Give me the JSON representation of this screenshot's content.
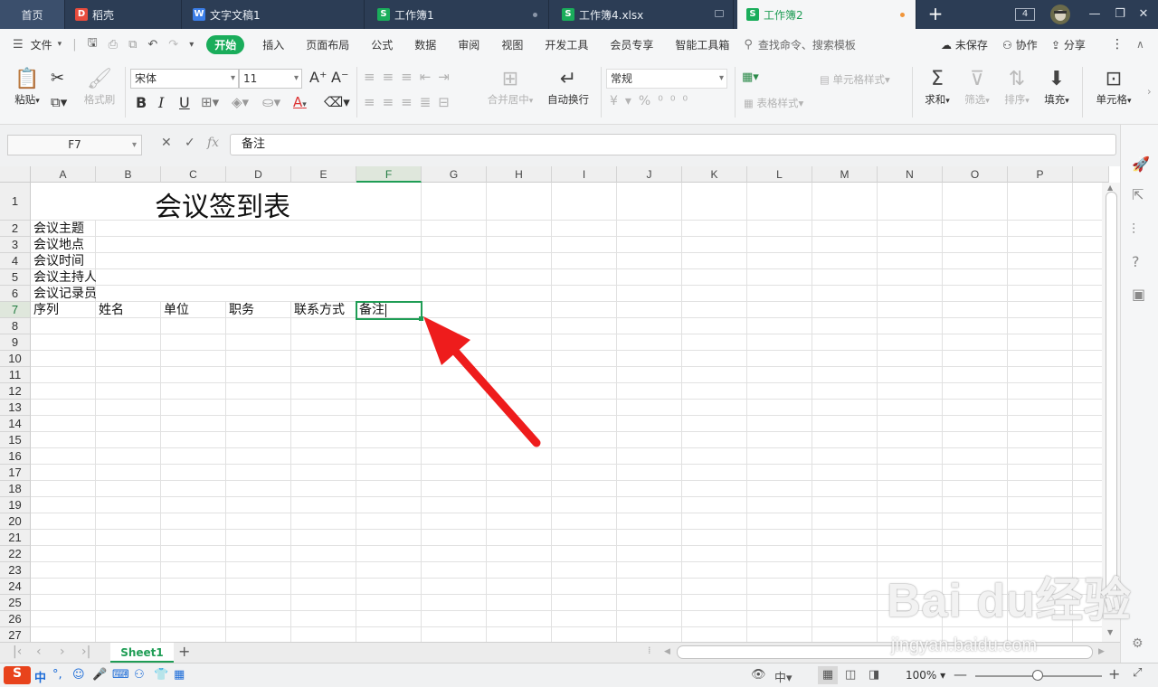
{
  "tabs": {
    "home": "首页",
    "items": [
      {
        "label": "稻壳",
        "icon": "docer-icon",
        "color": "#e84c3d"
      },
      {
        "label": "文字文稿1",
        "icon": "writer-icon",
        "color": "#3b7ee8"
      },
      {
        "label": "工作簿1",
        "icon": "spreadsheet-icon",
        "color": "#1aad5b"
      },
      {
        "label": "工作簿4.xlsx",
        "icon": "spreadsheet-icon",
        "color": "#1aad5b"
      },
      {
        "label": "工作簿2",
        "icon": "spreadsheet-icon",
        "color": "#1aad5b"
      }
    ],
    "window_count": "4"
  },
  "menu": {
    "file": "文件",
    "items": [
      "开始",
      "插入",
      "页面布局",
      "公式",
      "数据",
      "审阅",
      "视图",
      "开发工具",
      "会员专享",
      "智能工具箱"
    ],
    "search": "查找命令、搜索模板",
    "unsaved": "未保存",
    "collab": "协作",
    "share": "分享"
  },
  "ribbon": {
    "paste": "粘贴",
    "format_painter": "格式刷",
    "font_name": "宋体",
    "font_size": "11",
    "merge_center": "合并居中",
    "wrap_text": "自动换行",
    "number_format": "常规",
    "cell_style": "单元格样式",
    "table_style": "表格样式",
    "sum": "求和",
    "filter": "筛选",
    "sort": "排序",
    "fill": "填充",
    "cells": "单元格"
  },
  "formula_bar": {
    "name_box": "F7",
    "content": "备注"
  },
  "grid": {
    "columns": [
      "A",
      "B",
      "C",
      "D",
      "E",
      "F",
      "G",
      "H",
      "I",
      "J",
      "K",
      "L",
      "M",
      "N",
      "O",
      "P"
    ],
    "rows": [
      "1",
      "2",
      "3",
      "4",
      "5",
      "6",
      "7",
      "8",
      "9",
      "10",
      "11",
      "12",
      "13",
      "14",
      "15",
      "16",
      "17",
      "18",
      "19",
      "20",
      "21",
      "22",
      "23",
      "24",
      "25",
      "26",
      "27"
    ],
    "selected_column": "F",
    "selected_row": "7",
    "title": "会议签到表",
    "labels": [
      "会议主题",
      "会议地点",
      "会议时间",
      "会议主持人",
      "会议记录员"
    ],
    "headers": [
      "序列",
      "姓名",
      "单位",
      "职务",
      "联系方式",
      "备注"
    ]
  },
  "sheets": [
    "Sheet1"
  ],
  "status": {
    "zoom": "100%"
  },
  "watermark": {
    "main": "Bai du经验",
    "url": "jingyan.baidu.com"
  }
}
